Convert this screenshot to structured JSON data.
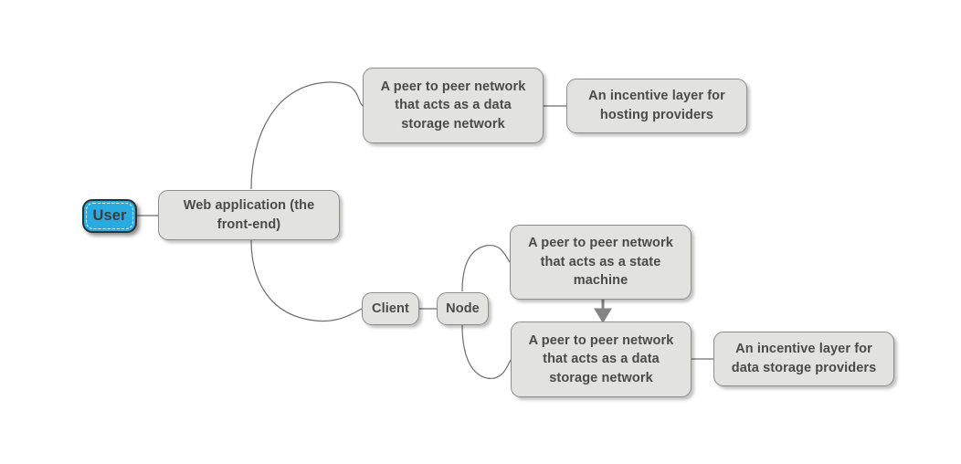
{
  "diagram": {
    "type": "mind-map",
    "background_color": "#ffffff",
    "node_fill": "#e2e2e0",
    "node_border": "#8c8c8c",
    "node_text_color": "#4a4a4a",
    "selected_fill": "#29abe2",
    "selected_border": "#2f2f2f",
    "edge_color": "#6e6e6e",
    "nodes": {
      "user": "User",
      "web_application": "Web application (the\nfront-end)",
      "p2p_data_storage_top": "A peer to peer network\nthat acts as a data\nstorage network",
      "incentive_hosting": "An incentive layer for\nhosting providers",
      "client": "Client",
      "node": "Node",
      "p2p_state_machine": "A peer to peer network\nthat acts as a state\nmachine",
      "p2p_data_storage_bottom": "A peer to peer network\nthat acts as a data\nstorage network",
      "incentive_data_storage": "An incentive layer for\ndata storage providers"
    }
  }
}
